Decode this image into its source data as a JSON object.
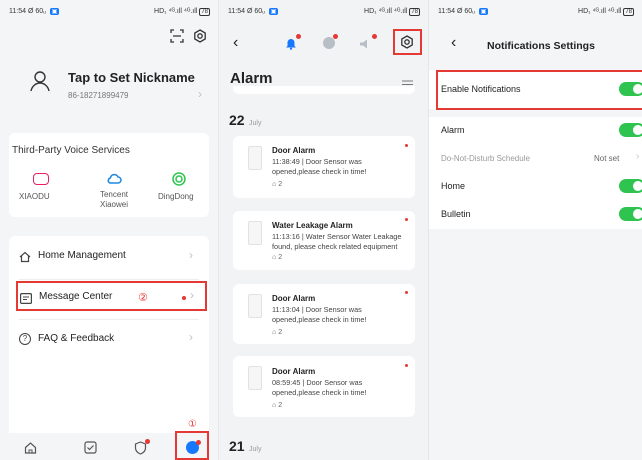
{
  "status": {
    "time": "11:54",
    "indicator": "60",
    "right": "HD₁ ⁴ᴳ.ıll ⁴ᴳ.ıll",
    "battery": "78"
  },
  "profile": {
    "name": "Tap to Set Nickname",
    "phone": "86-18271899479",
    "voice_title": "Third-Party Voice Services",
    "voice_items": [
      {
        "label": "XIAODU",
        "color": "#e91e63"
      },
      {
        "label": "Tencent\nXiaowei",
        "color": "#1e88e5"
      },
      {
        "label": "DingDong",
        "color": "#2ec44f"
      }
    ],
    "menu": [
      {
        "label": "Home Management"
      },
      {
        "label": "Message Center",
        "callout": "②"
      },
      {
        "label": "FAQ & Feedback"
      }
    ],
    "footer_callout": "①"
  },
  "messages": {
    "title": "Alarm",
    "sections": [
      {
        "date": "22",
        "month": "July"
      },
      {
        "date": "21",
        "month": "July"
      }
    ],
    "cards": [
      {
        "title": "Door Alarm",
        "body": "11:38:49 | Door Sensor was opened,please check in time!",
        "count": "2"
      },
      {
        "title": "Water Leakage Alarm",
        "body": "11:13:16 | Water Sensor Water Leakage found, please check related equipment",
        "count": "2"
      },
      {
        "title": "Door Alarm",
        "body": "11:13:04 | Door Sensor was opened,please check in time!",
        "count": "2"
      },
      {
        "title": "Door Alarm",
        "body": "08:59:45 | Door Sensor was opened,please check in time!",
        "count": "2"
      }
    ]
  },
  "settings": {
    "title": "Notifications Settings",
    "enable_label": "Enable Notifications",
    "rows": [
      {
        "label": "Alarm",
        "toggle": true
      },
      {
        "label": "Do-Not-Disturb Schedule",
        "value": "Not set"
      },
      {
        "label": "Home",
        "toggle": true
      },
      {
        "label": "Bulletin",
        "toggle": true
      }
    ]
  },
  "colors": {
    "accent": "#2ec44f",
    "annotation": "#e53935",
    "icon_blue": "#1677ff"
  }
}
